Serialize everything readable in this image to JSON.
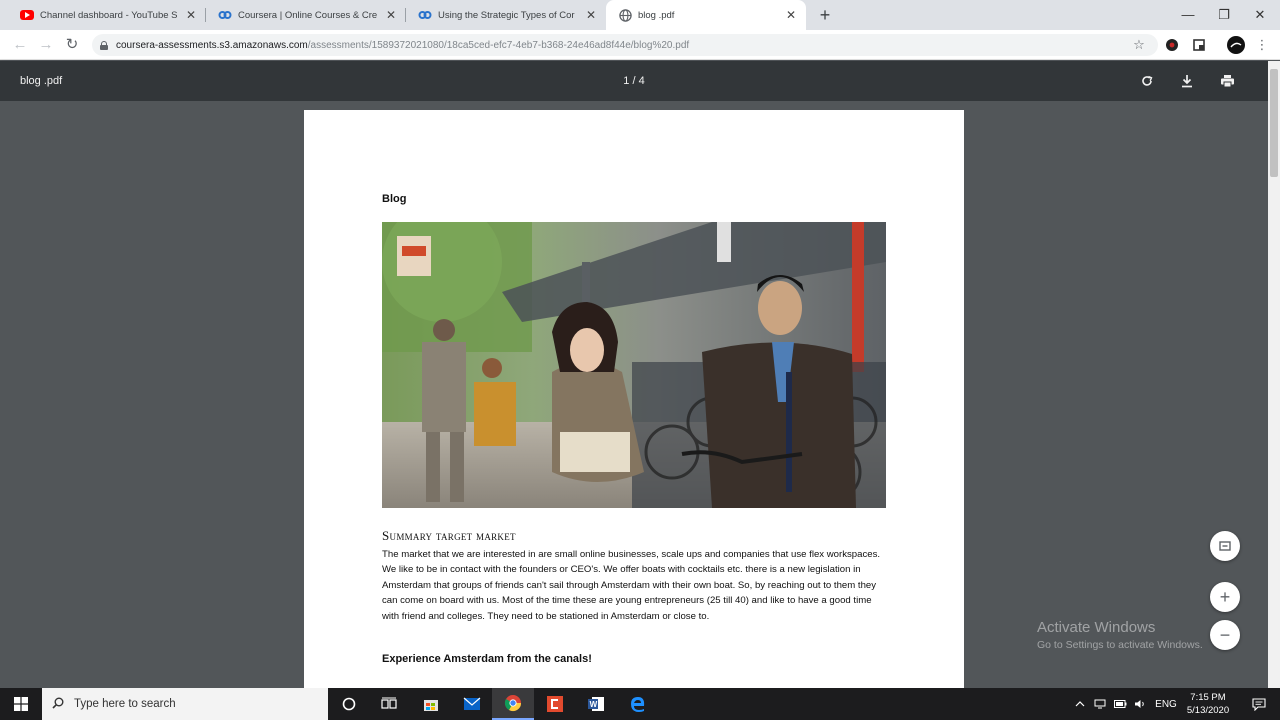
{
  "browser": {
    "tabs": [
      {
        "title": "Channel dashboard - YouTube S",
        "favicon": "youtube-icon",
        "active": false
      },
      {
        "title": "Coursera | Online Courses & Cre",
        "favicon": "coursera-icon",
        "active": false
      },
      {
        "title": "Using the Strategic Types of Cor",
        "favicon": "coursera-icon",
        "active": false
      },
      {
        "title": "blog .pdf",
        "favicon": "globe-icon",
        "active": true
      }
    ],
    "new_tab_label": "+",
    "url_host": "coursera-assessments.s3.amazonaws.com",
    "url_path": "/assessments/1589372021080/18ca5ced-efc7-4eb7-b368-24e46ad8f44e/blog%20.pdf"
  },
  "pdf_viewer": {
    "filename": "blog .pdf",
    "page_indicator": "1 / 4",
    "document": {
      "heading": "Blog",
      "section_title": "Summary target market",
      "paragraph": "The market that we are interested in are small online businesses, scale ups and companies that use flex workspaces. We like to be in contact with the founders or CEO's. We offer boats with cocktails etc. there is a new legislation in Amsterdam that groups of friends can't sail through Amsterdam with their own boat. So, by reaching out to them they can come on board with us. Most of the time these are young entrepreneurs (25 till 40)  and like to have a good time with friend and colleges. They need to be stationed in Amsterdam or close to.",
      "subheading": "Experience Amsterdam from the canals!"
    }
  },
  "watermark": {
    "line1": "Activate Windows",
    "line2": "Go to Settings to activate Windows."
  },
  "taskbar": {
    "search_placeholder": "Type here to search",
    "language": "ENG",
    "time": "7:15 PM",
    "date": "5/13/2020"
  },
  "colors": {
    "youtube_red": "#ff0000",
    "coursera_blue": "#2a73cc",
    "pdf_toolbar": "#323639",
    "viewer_background": "#525659"
  }
}
